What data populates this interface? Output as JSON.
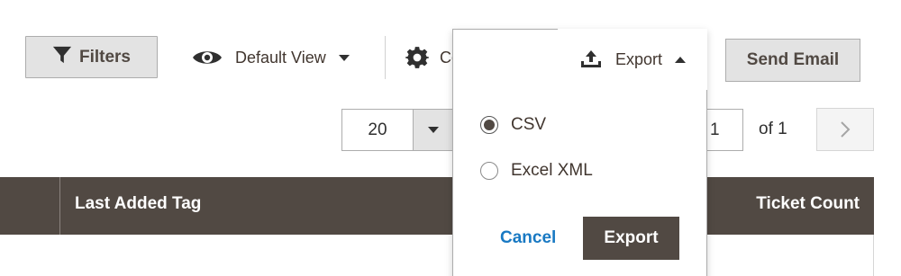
{
  "toolbar": {
    "filters_label": "Filters",
    "default_view_label": "Default View",
    "columns_label": "Columns",
    "export_label": "Export",
    "send_email_label": "Send Email"
  },
  "export_menu": {
    "options": [
      {
        "label": "CSV",
        "checked": true
      },
      {
        "label": "Excel XML",
        "checked": false
      }
    ],
    "cancel_label": "Cancel",
    "submit_label": "Export"
  },
  "pagination": {
    "per_page": "20",
    "current_page": "1",
    "of_label": "of 1"
  },
  "grid": {
    "columns": [
      "Last Added Tag",
      "Ticket Count"
    ]
  },
  "icons": {
    "filters": "filter-funnel-icon",
    "default_view": "eye-icon",
    "columns": "gear-icon",
    "export": "upload-tray-icon",
    "next": "chevron-right-icon"
  },
  "colors": {
    "header_bg": "#514943",
    "button_bg": "#e3e3e3",
    "link": "#1979c3",
    "text": "#41362f"
  }
}
